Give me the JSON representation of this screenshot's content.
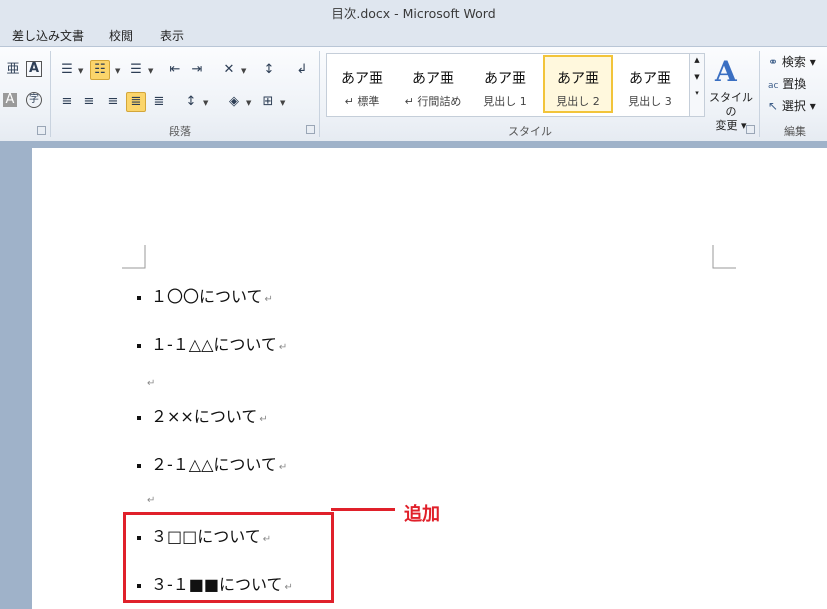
{
  "window": {
    "title": "目次.docx - Microsoft Word"
  },
  "tabs": [
    "差し込み文書",
    "校閲",
    "表示"
  ],
  "ribbon": {
    "groups": {
      "paragraph": "段落",
      "styles": "スタイル",
      "editing": "編集"
    },
    "styles_gallery": [
      {
        "sample": "あア亜",
        "name": "↵ 標準"
      },
      {
        "sample": "あア亜",
        "name": "↵ 行間詰め"
      },
      {
        "sample": "あア亜",
        "name": "見出し 1"
      },
      {
        "sample": "あア亜",
        "name": "見出し 2",
        "selected": true
      },
      {
        "sample": "あア亜",
        "name": "見出し 3"
      }
    ],
    "change_styles": {
      "line1": "スタイルの",
      "line2": "変更 ▾"
    },
    "editing": {
      "find": "検索 ▾",
      "replace": "置換",
      "select": "選択 ▾"
    }
  },
  "document": {
    "lines": [
      {
        "text": "１〇〇について",
        "bullet": true
      },
      {
        "text": "１-１△△について",
        "bullet": true
      },
      {
        "text": "",
        "bullet": false
      },
      {
        "text": "２××について",
        "bullet": true
      },
      {
        "text": "２-１△△について",
        "bullet": true
      },
      {
        "text": "",
        "bullet": false
      },
      {
        "text": "３□□について",
        "bullet": true
      },
      {
        "text": "３-１■■について",
        "bullet": true
      }
    ],
    "paragraph_mark": "↵"
  },
  "annotation": {
    "label": "追加",
    "color": "#e0202a"
  }
}
